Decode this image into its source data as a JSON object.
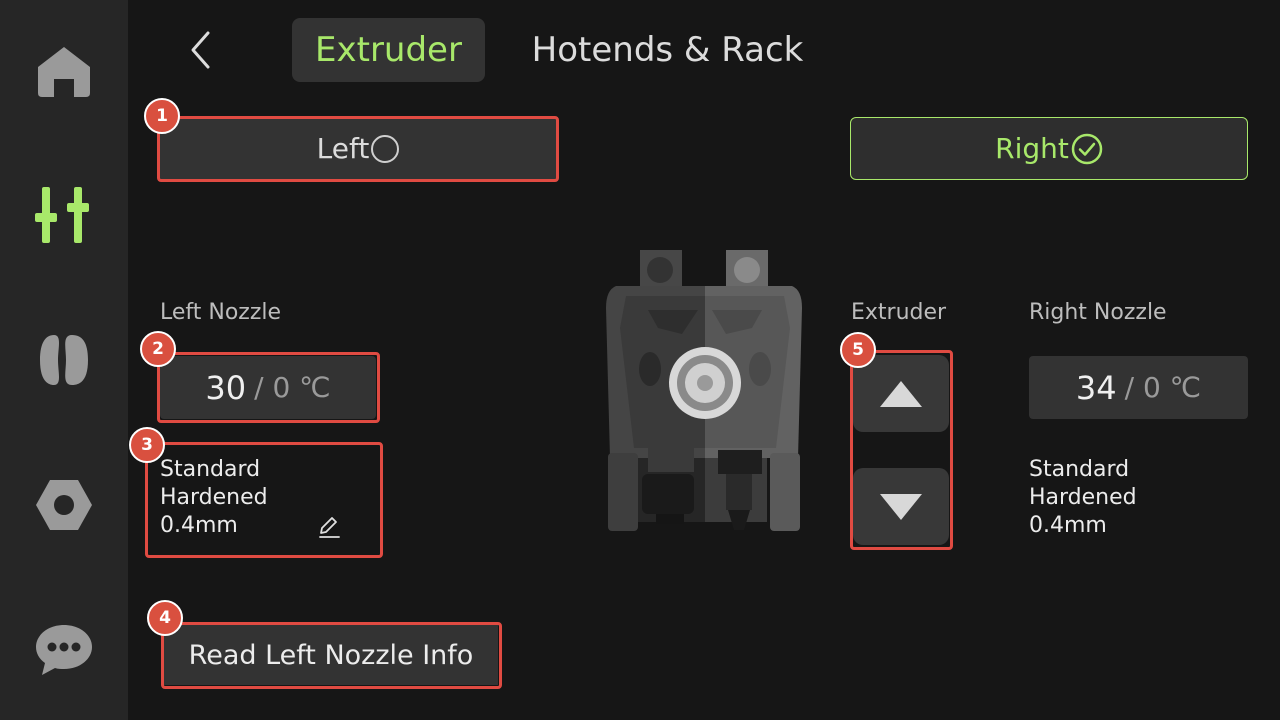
{
  "sidebar": {
    "items": [
      {
        "icon": "home-icon",
        "active": false
      },
      {
        "icon": "controls-icon",
        "active": true
      },
      {
        "icon": "filament-icon",
        "active": false
      },
      {
        "icon": "nut-icon",
        "active": false
      },
      {
        "icon": "message-icon",
        "active": false
      }
    ]
  },
  "header": {
    "tabs": [
      {
        "label": "Extruder",
        "active": true
      },
      {
        "label": "Hotends & Rack",
        "active": false
      }
    ]
  },
  "selector": {
    "left_label": "Left",
    "right_label": "Right",
    "selected": "right"
  },
  "left_nozzle": {
    "title": "Left Nozzle",
    "temp_current": "30",
    "temp_rest": "/ 0 ℃",
    "type": "Standard",
    "material": "Hardened",
    "diameter": "0.4mm"
  },
  "right_nozzle": {
    "title": "Right Nozzle",
    "temp_current": "34",
    "temp_rest": "/ 0 ℃",
    "type": "Standard",
    "material": "Hardened",
    "diameter": "0.4mm"
  },
  "extruder": {
    "label": "Extruder"
  },
  "read_button": {
    "label": "Read Left Nozzle Info"
  },
  "badges": [
    "1",
    "2",
    "3",
    "4",
    "5"
  ],
  "colors": {
    "accent": "#a8e86a",
    "highlight": "#e04b42",
    "background": "#161616",
    "sidebar": "#262626",
    "button": "#333333"
  }
}
